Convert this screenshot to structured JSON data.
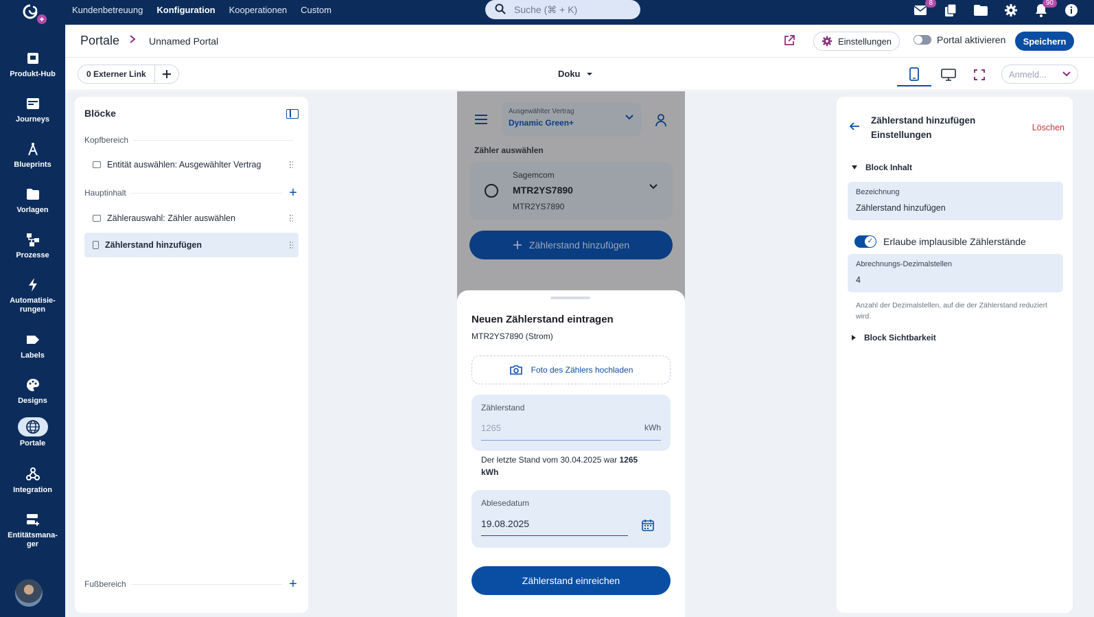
{
  "topbar": {
    "nav": [
      "Kundenbetreuung",
      "Konfiguration",
      "Kooperationen",
      "Custom"
    ],
    "active_nav": "Konfiguration",
    "search_placeholder": "Suche (⌘ + K)",
    "mail_badge": "8",
    "notifications_badge": "90",
    "icons": [
      "mail-icon",
      "documents-icon",
      "folder-icon",
      "gear-icon",
      "bell-icon",
      "info-icon"
    ]
  },
  "sidebar": {
    "items": [
      {
        "label": "Produkt-Hub",
        "icon": "store-icon"
      },
      {
        "label": "Journeys",
        "icon": "browser-icon"
      },
      {
        "label": "Blueprints",
        "icon": "compass-icon"
      },
      {
        "label": "Vorlagen",
        "icon": "folder-icon"
      },
      {
        "label": "Prozesse",
        "icon": "process-icon"
      },
      {
        "label": "Automatisie-\nrungen",
        "icon": "lightning-icon"
      },
      {
        "label": "Labels",
        "icon": "label-icon"
      },
      {
        "label": "Designs",
        "icon": "palette-icon"
      },
      {
        "label": "Portale",
        "icon": "globe-icon"
      },
      {
        "label": "Integration",
        "icon": "webhook-icon"
      },
      {
        "label": "Entitätsmana-\nger",
        "icon": "entity-icon"
      }
    ],
    "active": "Portale"
  },
  "header": {
    "breadcrumb_root": "Portale",
    "breadcrumb_current": "Unnamed Portal",
    "settings_label": "Einstellungen",
    "activate_label": "Portal aktivieren",
    "activate_on": false,
    "save_label": "Speichern"
  },
  "toolbar": {
    "external_links_label": "0 Externer Link",
    "page_select": "Doku",
    "login_placeholder": "Anmeld..."
  },
  "blocks_panel": {
    "title": "Blöcke",
    "sections": {
      "head": "Kopfbereich",
      "main": "Hauptinhalt",
      "footer": "Fußbereich"
    },
    "head_items": [
      "Entität auswählen: Ausgewählter Vertrag"
    ],
    "main_items": [
      "Zählerauswahl: Zähler auswählen",
      "Zählerstand hinzufügen"
    ],
    "selected": "Zählerstand hinzufügen"
  },
  "preview": {
    "contract_label": "Ausgewählter Vertrag",
    "contract_value": "Dynamic Green+",
    "meter_section_label": "Zähler auswählen",
    "meter_brand": "Sagemcom",
    "meter_id": "MTR2YS7890",
    "meter_id_sub": "MTR2YS7890",
    "add_button": "Zählerstand hinzufügen",
    "sheet_title": "Neuen Zählerstand eintragen",
    "sheet_subtitle": "MTR2YS7890 (Strom)",
    "upload_label": "Foto des Zählers hochladen",
    "reading_label": "Zählerstand",
    "reading_placeholder": "1265",
    "reading_unit": "kWh",
    "last_reading_prefix": "Der letzte Stand vom 30.04.2025 war",
    "last_reading_value": "1265",
    "last_reading_unit": "kWh",
    "date_label": "Ablesedatum",
    "date_value": "19.08.2025",
    "submit_label": "Zählerstand einreichen"
  },
  "settings_panel": {
    "title_line1": "Zählerstand hinzufügen",
    "title_line2": "Einstellungen",
    "delete_label": "Löschen",
    "content_section": "Block Inhalt",
    "name_label": "Bezeichnung",
    "name_value": "Zählerstand hinzufügen",
    "implausible_label": "Erlaube implausible Zählerstände",
    "implausible_on": true,
    "decimals_label": "Abrechnungs-Dezimalstellen",
    "decimals_value": "4",
    "decimals_help": "Anzahl der Dezimalstellen, auf die der Zählerstand reduziert wird.",
    "visibility_section": "Block Sichtbarkeit"
  },
  "colors": {
    "navy": "#0c2d5c",
    "primary": "#0a4ea3",
    "accent": "#8b2f7a",
    "danger": "#c8343a"
  }
}
